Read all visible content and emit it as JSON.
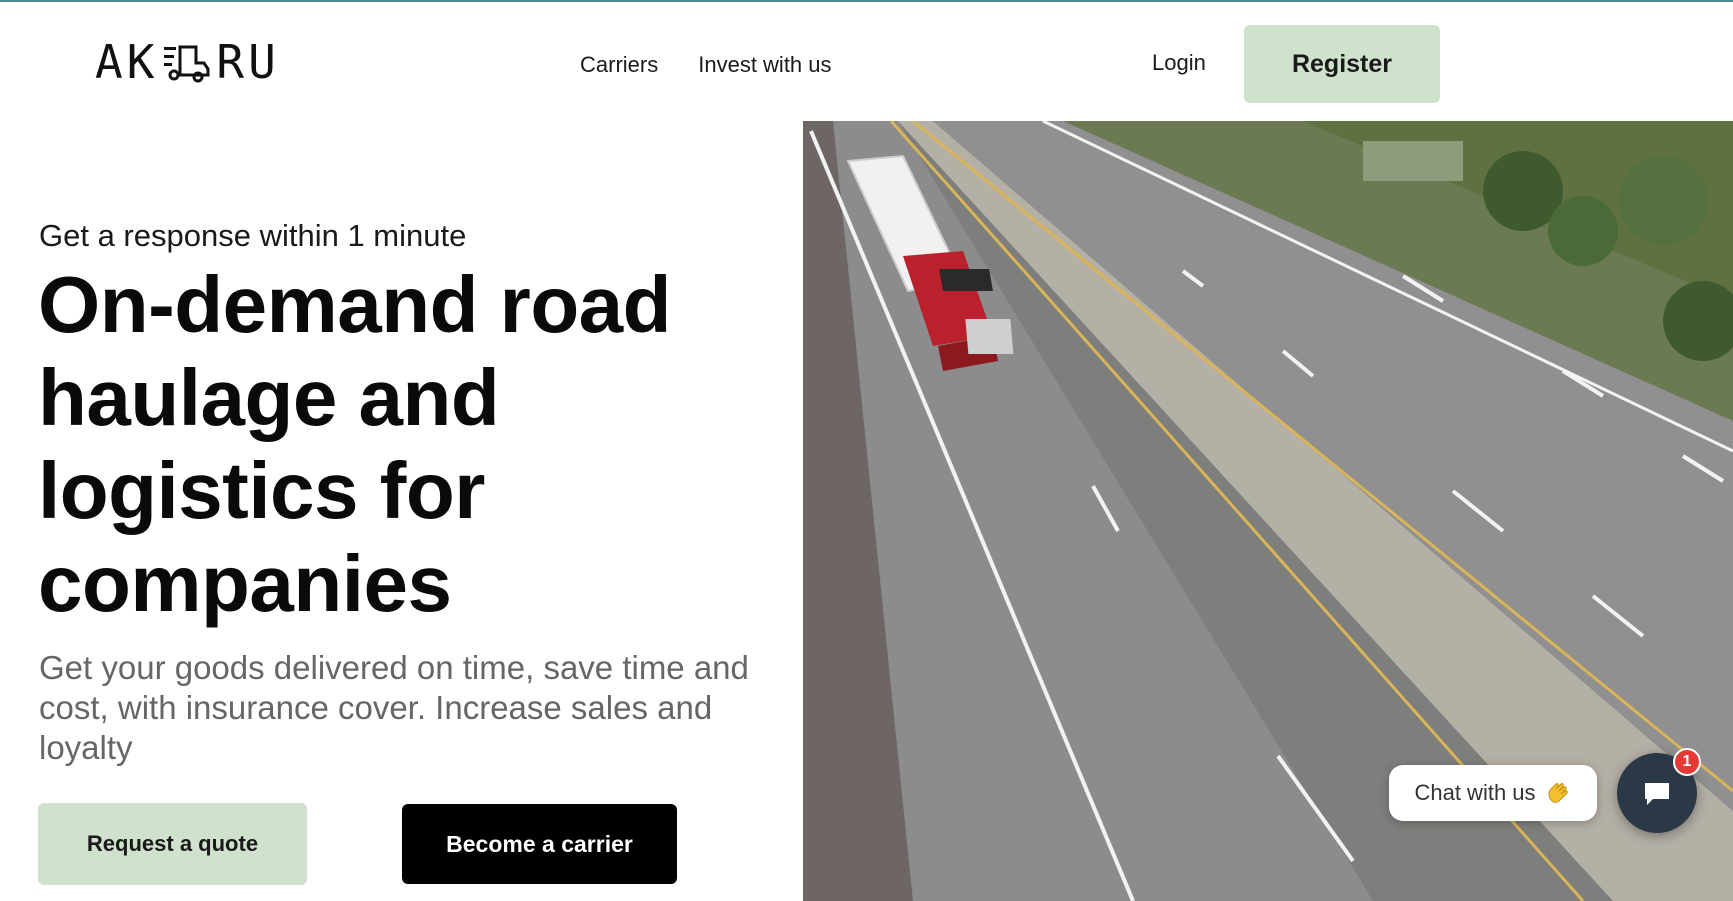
{
  "header": {
    "logo_left": "AK",
    "logo_right": "RU",
    "nav": [
      {
        "label": "Carriers"
      },
      {
        "label": "Invest with us"
      }
    ],
    "login_label": "Login",
    "register_label": "Register"
  },
  "hero": {
    "eyebrow": "Get a response within 1 minute",
    "headline": "On-demand road haulage and logistics for companies",
    "subtext": "Get your goods delivered on time, save time and cost, with insurance cover. Increase sales and loyalty",
    "quote_button": "Request a quote",
    "carrier_button": "Become a carrier"
  },
  "chat": {
    "label": "Chat with us",
    "badge_count": "1"
  },
  "colors": {
    "accent_green": "#cfe2cc",
    "black_button": "#000000",
    "top_line": "#4b8b95",
    "chat_button": "#2b3846",
    "badge": "#e53935"
  },
  "icons": {
    "logo_mark": "truck-logo-icon",
    "chat": "chat-icon",
    "wave": "waving-hand-icon"
  }
}
